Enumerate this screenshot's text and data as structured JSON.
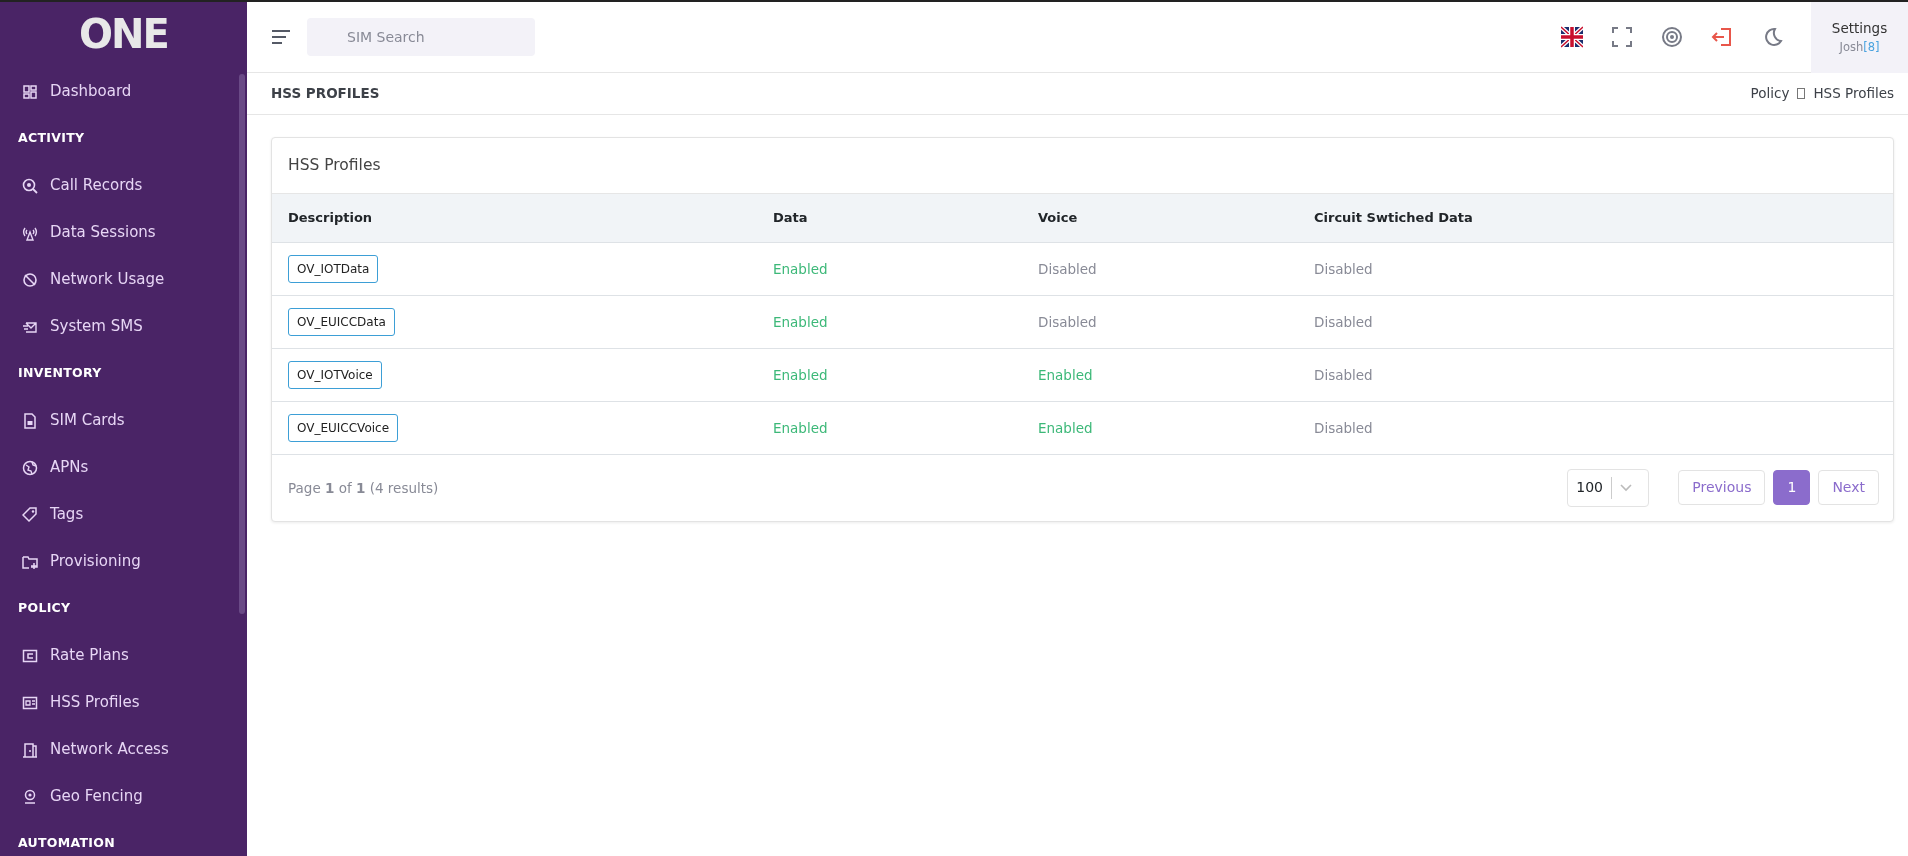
{
  "sidebar": {
    "logo": "ONE",
    "sections": [
      {
        "items": [
          {
            "label": "Dashboard",
            "selected": false
          }
        ]
      },
      {
        "heading": "ACTIVITY",
        "items": [
          {
            "label": "Call Records",
            "selected": false
          },
          {
            "label": "Data Sessions",
            "selected": false
          },
          {
            "label": "Network Usage",
            "selected": false
          },
          {
            "label": "System SMS",
            "selected": false
          }
        ]
      },
      {
        "heading": "INVENTORY",
        "items": [
          {
            "label": "SIM Cards",
            "selected": false
          },
          {
            "label": "APNs",
            "selected": false
          },
          {
            "label": "Tags",
            "selected": false
          },
          {
            "label": "Provisioning",
            "selected": false
          }
        ]
      },
      {
        "heading": "POLICY",
        "items": [
          {
            "label": "Rate Plans",
            "selected": false
          },
          {
            "label": "HSS Profiles",
            "selected": false
          },
          {
            "label": "Network Access",
            "selected": false
          },
          {
            "label": "Geo Fencing",
            "selected": false
          }
        ]
      },
      {
        "heading": "AUTOMATION"
      }
    ]
  },
  "topbar": {
    "search": {
      "placeholder": "SIM Search"
    },
    "settings": {
      "title": "Settings",
      "user": "Josh",
      "user_id": "[8]"
    }
  },
  "page_header": {
    "title": "HSS PROFILES",
    "breadcrumb": [
      "Policy",
      "HSS Profiles"
    ]
  },
  "card": {
    "title": "HSS Profiles",
    "table": {
      "columns": [
        "Description",
        "Data",
        "Voice",
        "Circuit Swtiched Data"
      ],
      "rows": [
        {
          "cells": [
            {
              "kind": "tag",
              "text": "OV_IOTData"
            },
            {
              "kind": "status",
              "text": "Enabled",
              "enabled": true
            },
            {
              "kind": "status",
              "text": "Disabled",
              "enabled": false
            },
            {
              "kind": "status",
              "text": "Disabled",
              "enabled": false
            }
          ]
        },
        {
          "cells": [
            {
              "kind": "tag",
              "text": "OV_EUICCData"
            },
            {
              "kind": "status",
              "text": "Enabled",
              "enabled": true
            },
            {
              "kind": "status",
              "text": "Disabled",
              "enabled": false
            },
            {
              "kind": "status",
              "text": "Disabled",
              "enabled": false
            }
          ]
        },
        {
          "cells": [
            {
              "kind": "tag",
              "text": "OV_IOTVoice"
            },
            {
              "kind": "status",
              "text": "Enabled",
              "enabled": true
            },
            {
              "kind": "status",
              "text": "Enabled",
              "enabled": true
            },
            {
              "kind": "status",
              "text": "Disabled",
              "enabled": false
            }
          ]
        },
        {
          "cells": [
            {
              "kind": "tag",
              "text": "OV_EUICCVoice"
            },
            {
              "kind": "status",
              "text": "Enabled",
              "enabled": true
            },
            {
              "kind": "status",
              "text": "Enabled",
              "enabled": true
            },
            {
              "kind": "status",
              "text": "Disabled",
              "enabled": false
            }
          ]
        }
      ]
    },
    "footer": {
      "summary": "Page **1** of **1** (4 results)",
      "page_size": "100",
      "previous": "Previous",
      "pages": [
        {
          "label": "1",
          "selected": true
        }
      ],
      "next": "Next"
    }
  }
}
